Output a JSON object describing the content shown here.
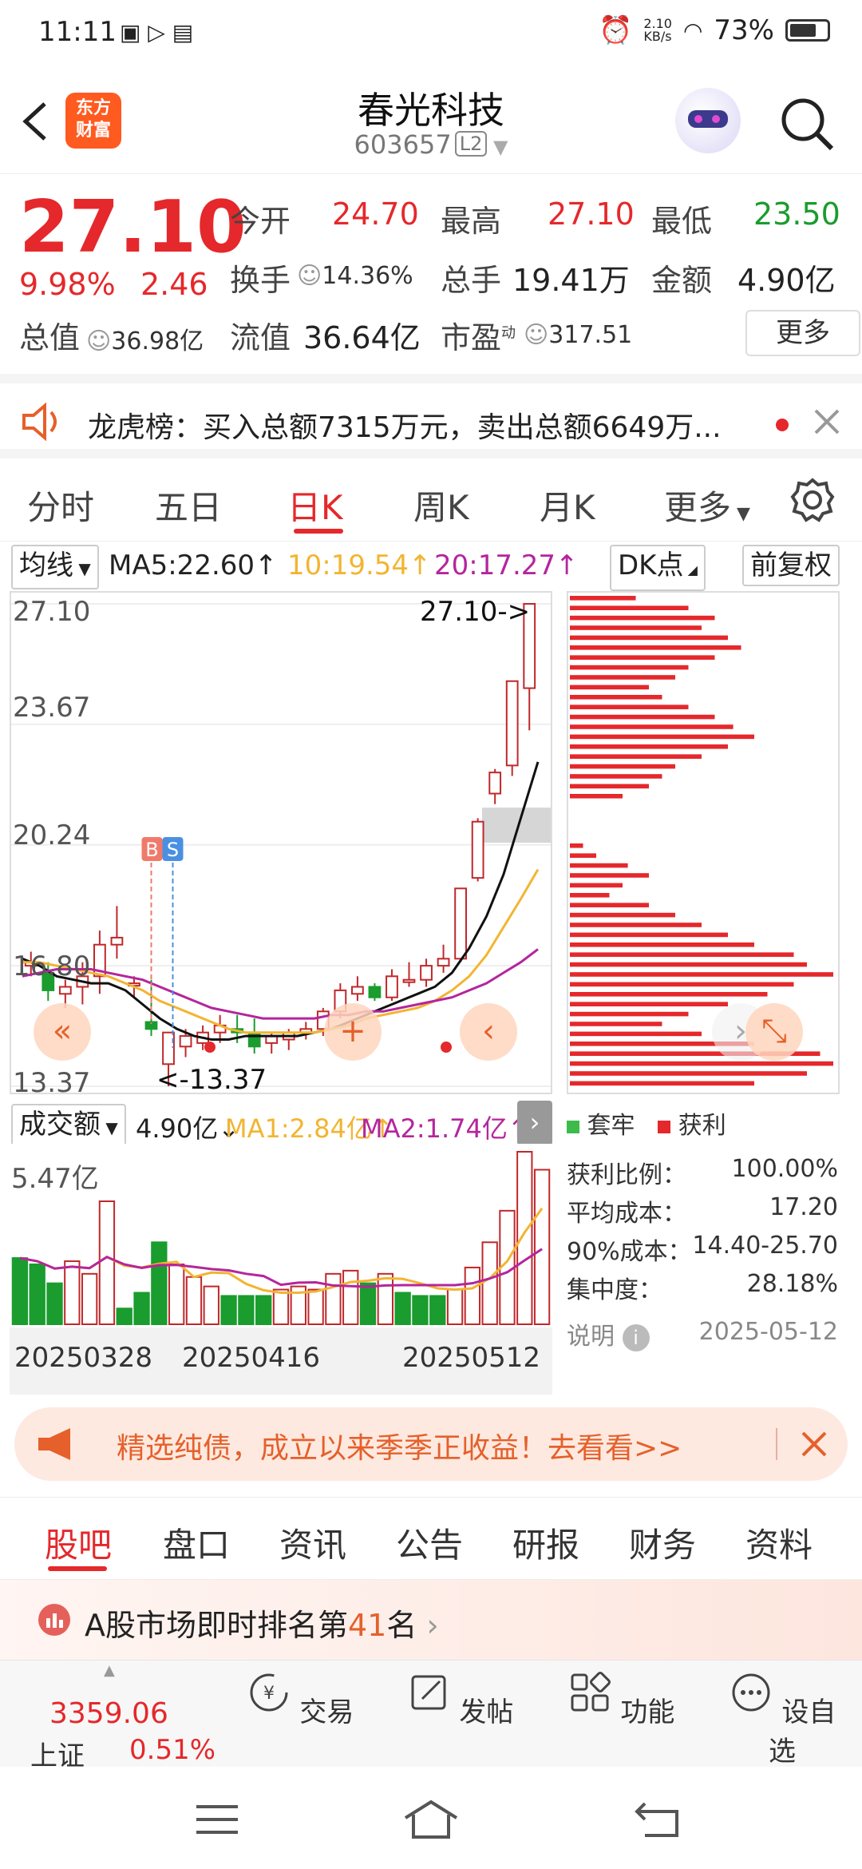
{
  "status": {
    "time": "11:11",
    "net_speed": "2.10\nKB/s",
    "battery": "73%",
    "battery_level": 0.73
  },
  "header": {
    "name": "春光科技",
    "code": "603657",
    "level": "L2",
    "logo_text": "东方财富"
  },
  "quote": {
    "price": "27.10",
    "change_pct": "9.98%",
    "change": "2.46",
    "open_label": "今开",
    "open": "24.70",
    "high_label": "最高",
    "high": "27.10",
    "low_label": "最低",
    "low": "23.50",
    "turnover_label": "换手",
    "turnover": "14.36%",
    "volume_label": "总手",
    "volume": "19.41万",
    "amount_label": "金额",
    "amount": "4.90亿",
    "mktcap_label": "总值",
    "mktcap": "36.98亿",
    "float_label": "流值",
    "float": "36.64亿",
    "pe_label": "市盈",
    "pe_sup": "动",
    "pe": "317.51",
    "more": "更多"
  },
  "notice": {
    "text": "龙虎榜：买入总额7315万元，卖出总额6649万..."
  },
  "tabs": [
    "分时",
    "五日",
    "日K",
    "周K",
    "月K",
    "更多"
  ],
  "active_tab": "日K",
  "ma": {
    "selector": "均线",
    "ma5": "MA5:22.60↑",
    "ma10": "10:19.54↑",
    "ma20": "20:17.27↑",
    "dk": "DK点",
    "adjust": "前复权"
  },
  "chart_data": {
    "type": "candlestick",
    "y_ticks": [
      "27.10",
      "23.67",
      "20.24",
      "16.80",
      "13.37"
    ],
    "ylim": [
      13.37,
      27.1
    ],
    "max_label": "27.10->",
    "min_label": "<-13.37",
    "x_labels": [
      "20250328",
      "20250416",
      "20250512"
    ],
    "candles": [
      {
        "o": 16.8,
        "h": 17.2,
        "l": 16.5,
        "c": 16.9
      },
      {
        "o": 16.6,
        "h": 16.9,
        "l": 15.8,
        "c": 16.1
      },
      {
        "o": 16.0,
        "h": 16.4,
        "l": 15.6,
        "c": 16.2
      },
      {
        "o": 16.2,
        "h": 16.9,
        "l": 15.7,
        "c": 16.5
      },
      {
        "o": 16.5,
        "h": 17.8,
        "l": 16.0,
        "c": 17.4
      },
      {
        "o": 17.4,
        "h": 18.5,
        "l": 17.0,
        "c": 17.6
      },
      {
        "o": 16.3,
        "h": 16.5,
        "l": 15.9,
        "c": 16.3
      },
      {
        "o": 15.2,
        "h": 16.4,
        "l": 14.8,
        "c": 15.0
      },
      {
        "o": 14.0,
        "h": 14.9,
        "l": 13.37,
        "c": 14.9
      },
      {
        "o": 14.5,
        "h": 15.0,
        "l": 14.2,
        "c": 14.8
      },
      {
        "o": 14.6,
        "h": 15.1,
        "l": 14.4,
        "c": 14.9
      },
      {
        "o": 14.9,
        "h": 15.4,
        "l": 14.6,
        "c": 15.1
      },
      {
        "o": 15.0,
        "h": 15.4,
        "l": 14.6,
        "c": 14.9
      },
      {
        "o": 14.9,
        "h": 15.3,
        "l": 14.3,
        "c": 14.5
      },
      {
        "o": 14.6,
        "h": 14.9,
        "l": 14.3,
        "c": 14.8
      },
      {
        "o": 14.7,
        "h": 15.0,
        "l": 14.4,
        "c": 14.9
      },
      {
        "o": 14.9,
        "h": 15.2,
        "l": 14.7,
        "c": 15.0
      },
      {
        "o": 15.0,
        "h": 15.6,
        "l": 14.8,
        "c": 15.5
      },
      {
        "o": 15.5,
        "h": 16.3,
        "l": 15.3,
        "c": 16.1
      },
      {
        "o": 16.0,
        "h": 16.5,
        "l": 15.8,
        "c": 16.2
      },
      {
        "o": 16.2,
        "h": 16.3,
        "l": 15.8,
        "c": 15.9
      },
      {
        "o": 15.9,
        "h": 16.7,
        "l": 15.8,
        "c": 16.5
      },
      {
        "o": 16.4,
        "h": 16.9,
        "l": 16.2,
        "c": 16.4
      },
      {
        "o": 16.4,
        "h": 17.0,
        "l": 16.2,
        "c": 16.8
      },
      {
        "o": 16.8,
        "h": 17.4,
        "l": 16.6,
        "c": 17.0
      },
      {
        "o": 17.0,
        "h": 19.0,
        "l": 16.9,
        "c": 19.0
      },
      {
        "o": 19.3,
        "h": 21.0,
        "l": 19.2,
        "c": 20.9
      },
      {
        "o": 21.7,
        "h": 22.4,
        "l": 21.4,
        "c": 22.3
      },
      {
        "o": 22.5,
        "h": 24.9,
        "l": 22.2,
        "c": 24.9
      },
      {
        "o": 24.7,
        "h": 27.1,
        "l": 23.5,
        "c": 27.1
      }
    ],
    "ma5": [
      17.0,
      16.8,
      16.5,
      16.4,
      16.3,
      16.3,
      16.1,
      15.7,
      15.3,
      15.0,
      14.8,
      14.7,
      14.7,
      14.8,
      14.8,
      14.8,
      14.8,
      14.9,
      15.0,
      15.2,
      15.4,
      15.6,
      15.8,
      16.0,
      16.2,
      16.6,
      17.3,
      18.2,
      19.4,
      21.0,
      22.6
    ],
    "ma10": [
      16.9,
      16.9,
      16.8,
      16.7,
      16.6,
      16.5,
      16.3,
      16.1,
      15.8,
      15.6,
      15.4,
      15.2,
      15.0,
      14.9,
      14.9,
      14.9,
      14.9,
      14.9,
      15.0,
      15.1,
      15.3,
      15.4,
      15.5,
      15.6,
      15.8,
      16.1,
      16.5,
      17.1,
      17.9,
      18.7,
      19.54
    ],
    "ma20": [
      16.5,
      16.6,
      16.7,
      16.7,
      16.7,
      16.6,
      16.5,
      16.4,
      16.2,
      16.0,
      15.8,
      15.6,
      15.5,
      15.4,
      15.3,
      15.3,
      15.3,
      15.3,
      15.4,
      15.4,
      15.5,
      15.5,
      15.6,
      15.7,
      15.8,
      15.9,
      16.1,
      16.3,
      16.6,
      16.9,
      17.27
    ],
    "colors": {
      "up": "#c0282a",
      "down": "#1a9c2e",
      "ma5": "#111111",
      "ma10": "#f2b531",
      "ma20": "#b5259c"
    },
    "bs_markers": [
      "B",
      "S"
    ]
  },
  "volume": {
    "selector": "成交额",
    "value": "4.90亿↓",
    "ma1": "MA1:2.84亿↑",
    "ma2": "MA2:1.74亿↑",
    "max_label": "5.47亿",
    "values": [
      2.1,
      1.9,
      1.3,
      2.0,
      1.6,
      3.9,
      0.5,
      1.0,
      2.6,
      1.9,
      1.5,
      1.2,
      0.9,
      0.9,
      0.9,
      1.1,
      1.2,
      1.1,
      1.6,
      1.7,
      1.3,
      1.6,
      1.0,
      0.9,
      0.9,
      1.1,
      1.8,
      2.6,
      3.6,
      5.47,
      4.9
    ],
    "up": [
      false,
      false,
      false,
      true,
      true,
      true,
      false,
      false,
      false,
      true,
      true,
      true,
      false,
      false,
      false,
      true,
      true,
      true,
      true,
      true,
      false,
      true,
      false,
      false,
      false,
      true,
      true,
      true,
      true,
      true,
      true
    ]
  },
  "profile": {
    "legend_trapped": "套牢",
    "legend_profit": "获利",
    "bars": [
      0.25,
      0.45,
      0.55,
      0.5,
      0.6,
      0.65,
      0.55,
      0.45,
      0.4,
      0.3,
      0.35,
      0.45,
      0.55,
      0.62,
      0.7,
      0.6,
      0.5,
      0.4,
      0.35,
      0.3,
      0.2,
      0.0,
      0.0,
      0.0,
      0.0,
      0.05,
      0.1,
      0.22,
      0.3,
      0.2,
      0.15,
      0.3,
      0.4,
      0.5,
      0.6,
      0.7,
      0.85,
      0.9,
      1.0,
      0.85,
      0.75,
      0.6,
      0.45,
      0.35,
      0.5,
      0.7,
      0.95,
      1.0,
      0.9,
      0.7
    ]
  },
  "stats": [
    {
      "label": "获利比例：",
      "value": "100.00%"
    },
    {
      "label": "平均成本：",
      "value": "17.20"
    },
    {
      "label": "90%成本：",
      "value": "14.40-25.70"
    },
    {
      "label": "集中度：",
      "value": "28.18%"
    }
  ],
  "stats_note": {
    "label": "说明",
    "date": "2025-05-12"
  },
  "ad": {
    "text": "精选纯债，成立以来季季正收益！去看看>>"
  },
  "bottom_tabs": [
    "股吧",
    "盘口",
    "资讯",
    "公告",
    "研报",
    "财务",
    "资料"
  ],
  "active_bottom_tab": "股吧",
  "rank": {
    "prefix": "A股市场即时排名第",
    "num": "41",
    "suffix": "名"
  },
  "index": {
    "value": "3359.06",
    "name": "上证",
    "pct": "0.51%"
  },
  "toolbar": [
    "交易",
    "发帖",
    "功能",
    "设自选"
  ]
}
